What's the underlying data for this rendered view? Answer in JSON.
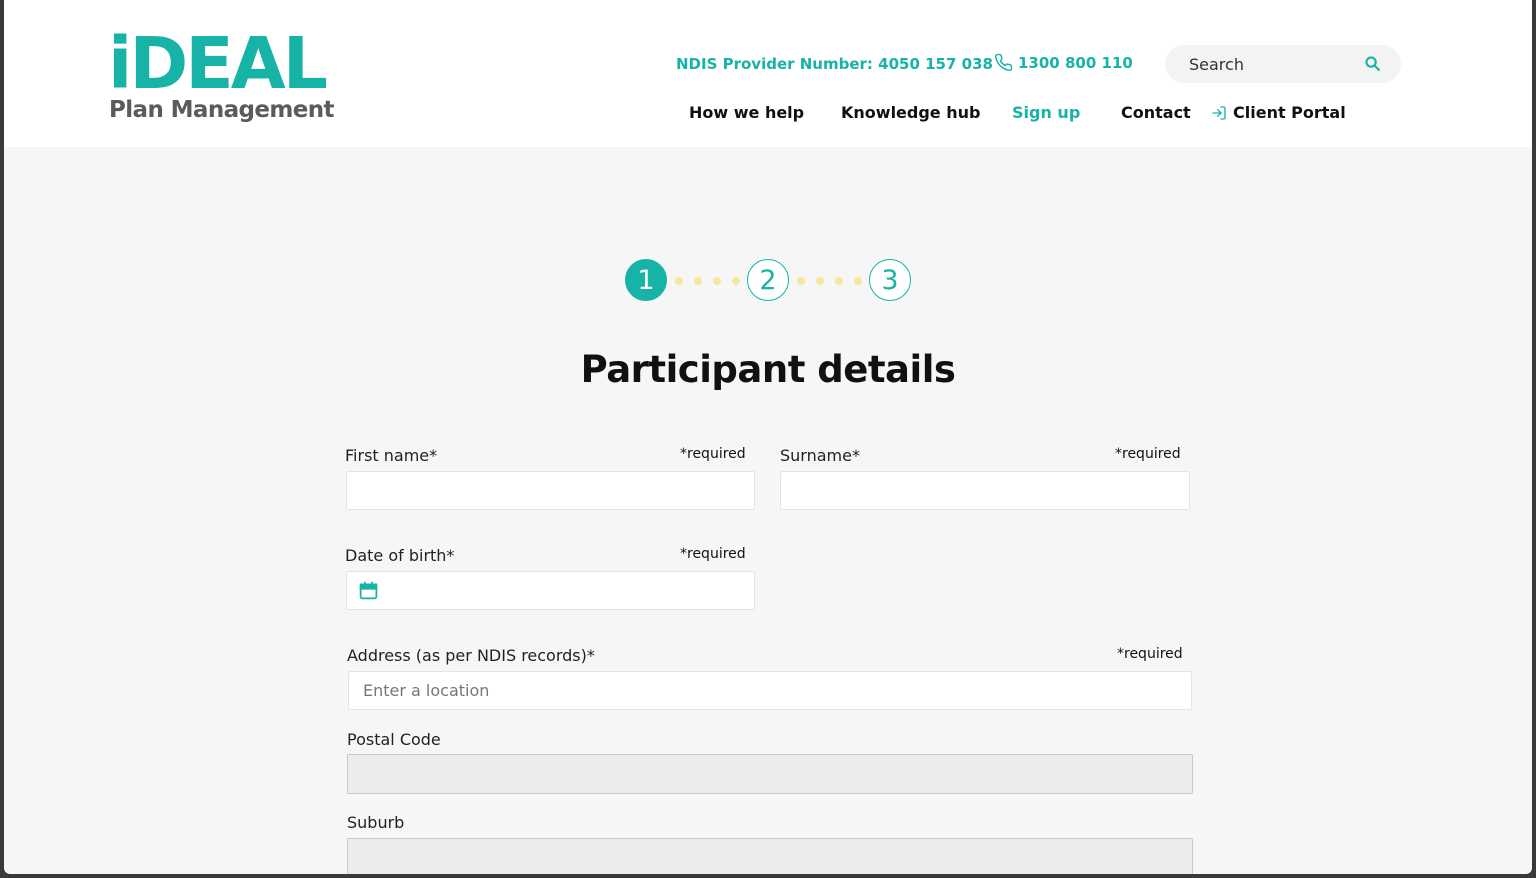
{
  "header": {
    "logo": {
      "main": "iDEAL",
      "sub": "Plan Management"
    },
    "provider_number": "NDIS Provider Number: 4050 157 038",
    "phone": "1300 800 110",
    "search": {
      "placeholder": "Search"
    },
    "nav": [
      {
        "label": "How we help"
      },
      {
        "label": "Knowledge hub"
      },
      {
        "label": "Sign up",
        "active": true
      },
      {
        "label": "Contact"
      },
      {
        "label": "Client Portal"
      }
    ]
  },
  "stepper": {
    "steps": [
      "1",
      "2",
      "3"
    ],
    "current": 1
  },
  "form": {
    "title": "Participant details",
    "required_note": "*required",
    "fields": {
      "first_name": {
        "label": "First name*",
        "value": ""
      },
      "surname": {
        "label": "Surname*",
        "value": ""
      },
      "dob": {
        "label": "Date of birth*",
        "value": ""
      },
      "address": {
        "label": "Address (as per NDIS records)*",
        "placeholder": "Enter a location",
        "value": ""
      },
      "postal_code": {
        "label": "Postal Code",
        "value": ""
      },
      "suburb": {
        "label": "Suburb",
        "value": ""
      }
    }
  },
  "colors": {
    "accent": "#17b3a7",
    "logo_grey": "#5b5b5b",
    "dots": "#f6e79b",
    "page_bg": "#f6f6f6"
  }
}
